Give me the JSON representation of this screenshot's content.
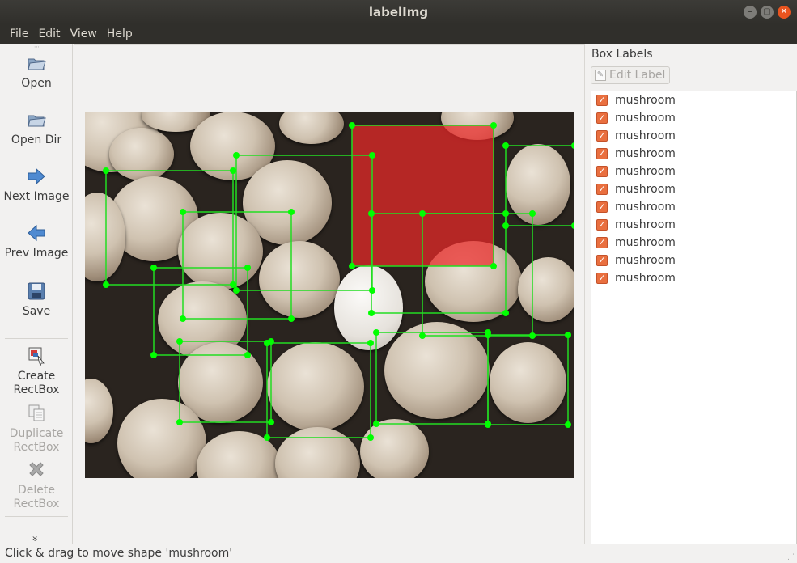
{
  "window": {
    "title": "labelImg"
  },
  "window_buttons": [
    "–",
    "▢",
    "✕"
  ],
  "menu": [
    {
      "label": "File"
    },
    {
      "label": "Edit"
    },
    {
      "label": "View"
    },
    {
      "label": "Help"
    }
  ],
  "toolbar": {
    "open": "Open",
    "open_dir": "Open Dir",
    "next_image": "Next Image",
    "prev_image": "Prev Image",
    "save": "Save",
    "create_rectbox_1": "Create",
    "create_rectbox_2": "RectBox",
    "duplicate_rectbox_1": "Duplicate",
    "duplicate_rectbox_2": "RectBox",
    "delete_rectbox_1": "Delete",
    "delete_rectbox_2": "RectBox",
    "more": "»"
  },
  "right_panel": {
    "title": "Box Labels",
    "edit_label_button": "Edit Label",
    "labels": [
      {
        "text": "mushroom",
        "checked": true
      },
      {
        "text": "mushroom",
        "checked": true
      },
      {
        "text": "mushroom",
        "checked": true
      },
      {
        "text": "mushroom",
        "checked": true
      },
      {
        "text": "mushroom",
        "checked": true
      },
      {
        "text": "mushroom",
        "checked": true
      },
      {
        "text": "mushroom",
        "checked": true
      },
      {
        "text": "mushroom",
        "checked": true
      },
      {
        "text": "mushroom",
        "checked": true
      },
      {
        "text": "mushroom",
        "checked": true
      },
      {
        "text": "mushroom",
        "checked": true
      }
    ]
  },
  "status": {
    "text": "Click & drag to move shape 'mushroom'"
  },
  "colors": {
    "box_stroke": "#22dd22",
    "box_handle": "#00ff00",
    "selected_fill": "#ff0000",
    "checkbox": "#e96f3f",
    "titlebar": "#3c3b37"
  }
}
